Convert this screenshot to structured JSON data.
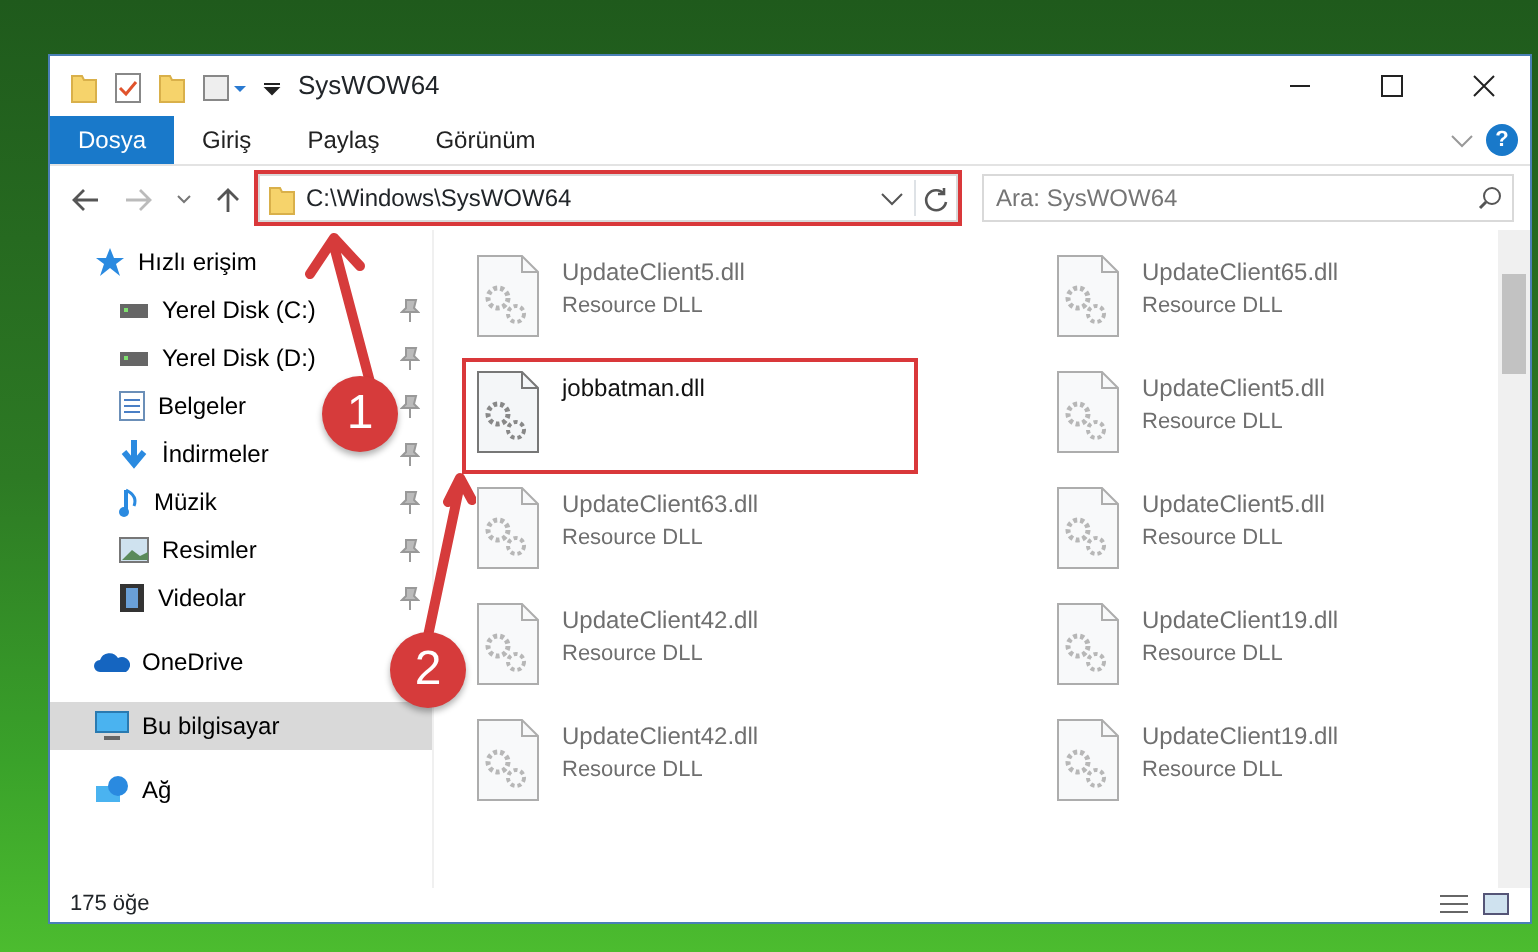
{
  "window": {
    "title": "SysWOW64"
  },
  "help": {
    "label": "?"
  },
  "ribbon_tabs": [
    {
      "label": "Dosya",
      "selected": true
    },
    {
      "label": "Giriş",
      "selected": false
    },
    {
      "label": "Paylaş",
      "selected": false
    },
    {
      "label": "Görünüm",
      "selected": false
    }
  ],
  "address_bar": {
    "path": "C:\\Windows\\SysWOW64",
    "highlighted": true
  },
  "search": {
    "placeholder": "Ara: SysWOW64"
  },
  "sidebar": {
    "items": [
      {
        "label": "Hızlı erişim",
        "kind": "star",
        "pinned": false,
        "selected": false,
        "children": [
          {
            "label": "Yerel Disk (C:)",
            "kind": "drive",
            "pinned": true,
            "selected": false
          },
          {
            "label": "Yerel Disk (D:)",
            "kind": "drive",
            "pinned": true,
            "selected": false
          },
          {
            "label": "Belgeler",
            "kind": "document",
            "pinned": true,
            "selected": false
          },
          {
            "label": "İndirmeler",
            "kind": "download",
            "pinned": true,
            "selected": false
          },
          {
            "label": "Müzik",
            "kind": "music",
            "pinned": true,
            "selected": false
          },
          {
            "label": "Resimler",
            "kind": "picture",
            "pinned": true,
            "selected": false
          },
          {
            "label": "Videolar",
            "kind": "video",
            "pinned": true,
            "selected": false
          }
        ]
      },
      {
        "label": "OneDrive",
        "kind": "cloud",
        "pinned": false,
        "selected": false
      },
      {
        "label": "Bu bilgisayar",
        "kind": "computer",
        "pinned": false,
        "selected": true
      },
      {
        "label": "Ağ",
        "kind": "network",
        "pinned": false,
        "selected": false
      }
    ]
  },
  "files": [
    {
      "name": "UpdateClient5.dll",
      "type": "Resource DLL",
      "blurred": true,
      "highlighted": false
    },
    {
      "name": "UpdateClient65.dll",
      "type": "Resource DLL",
      "blurred": true,
      "highlighted": false
    },
    {
      "name": "jobbatman.dll",
      "blurred": false,
      "highlighted": true
    },
    {
      "name": "UpdateClient5.dll",
      "type": "Resource DLL",
      "blurred": true,
      "highlighted": false
    },
    {
      "name": "UpdateClient63.dll",
      "type": "Resource DLL",
      "blurred": true,
      "highlighted": false
    },
    {
      "name": "UpdateClient5.dll",
      "type": "Resource DLL",
      "blurred": true,
      "highlighted": false
    },
    {
      "name": "UpdateClient42.dll",
      "type": "Resource DLL",
      "blurred": true,
      "highlighted": false
    },
    {
      "name": "UpdateClient19.dll",
      "type": "Resource DLL",
      "blurred": true,
      "highlighted": false
    },
    {
      "name": "UpdateClient42.dll",
      "type": "Resource DLL",
      "blurred": true,
      "highlighted": false
    },
    {
      "name": "UpdateClient19.dll",
      "type": "Resource DLL",
      "blurred": true,
      "highlighted": false
    }
  ],
  "annotations": [
    {
      "number": "1"
    },
    {
      "number": "2"
    }
  ],
  "status_bar": {
    "count": "175 öğe"
  }
}
